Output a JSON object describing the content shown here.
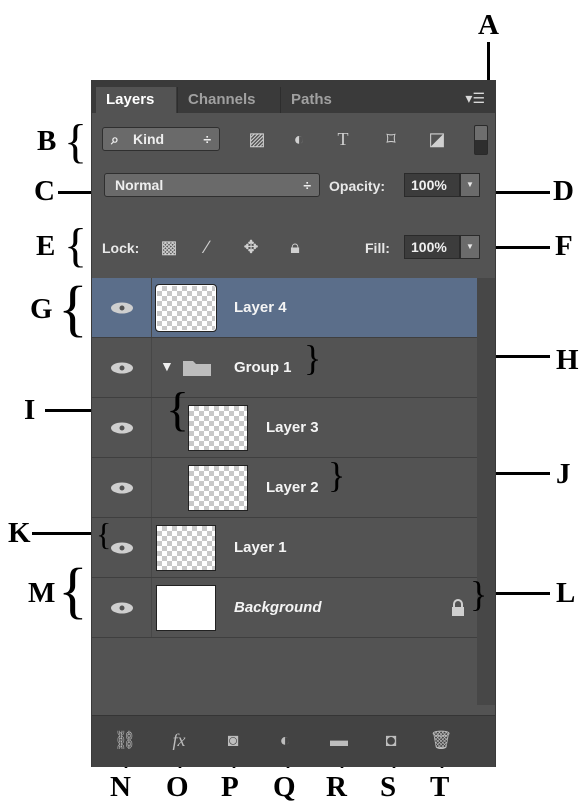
{
  "panel": {
    "tabs": [
      "Layers",
      "Channels",
      "Paths"
    ],
    "active_tab": "Layers",
    "menu_icon": "panel-menu-icon"
  },
  "filter": {
    "kind_label": "Kind",
    "kind_arrows": "÷",
    "icons": [
      "image-filter-icon",
      "adjustment-filter-icon",
      "type-filter-icon",
      "shape-filter-icon",
      "smart-object-filter-icon",
      "filter-toggle-icon"
    ]
  },
  "blend": {
    "mode": "Normal",
    "opacity_label": "Opacity:",
    "opacity_value": "100%"
  },
  "lock": {
    "label": "Lock:",
    "icons": [
      "lock-transparent-pixels-icon",
      "lock-image-pixels-icon",
      "lock-position-icon",
      "lock-all-icon"
    ],
    "fill_label": "Fill:",
    "fill_value": "100%"
  },
  "layers": [
    {
      "name": "Layer 4",
      "selected": true
    },
    {
      "name": "Group 1",
      "type": "group"
    },
    {
      "name": "Layer 3"
    },
    {
      "name": "Layer 2"
    },
    {
      "name": "Layer 1"
    },
    {
      "name": "Background",
      "locked": true
    }
  ],
  "footer_icons": [
    "link-layers-icon",
    "fx-icon",
    "add-mask-icon",
    "new-adjustment-layer-icon",
    "new-group-icon",
    "new-layer-icon",
    "delete-layer-icon"
  ],
  "callouts": {
    "A": "A",
    "B": "B",
    "C": "C",
    "D": "D",
    "E": "E",
    "F": "F",
    "G": "G",
    "H": "H",
    "I": "I",
    "J": "J",
    "K": "K",
    "L": "L",
    "M": "M",
    "N": "N",
    "O": "O",
    "P": "P",
    "Q": "Q",
    "R": "R",
    "S": "S",
    "T": "T"
  },
  "colors": {
    "panel_bg": "#535353",
    "selected_row": "#5b6e8a",
    "tab_bar": "#3a3a3a"
  }
}
